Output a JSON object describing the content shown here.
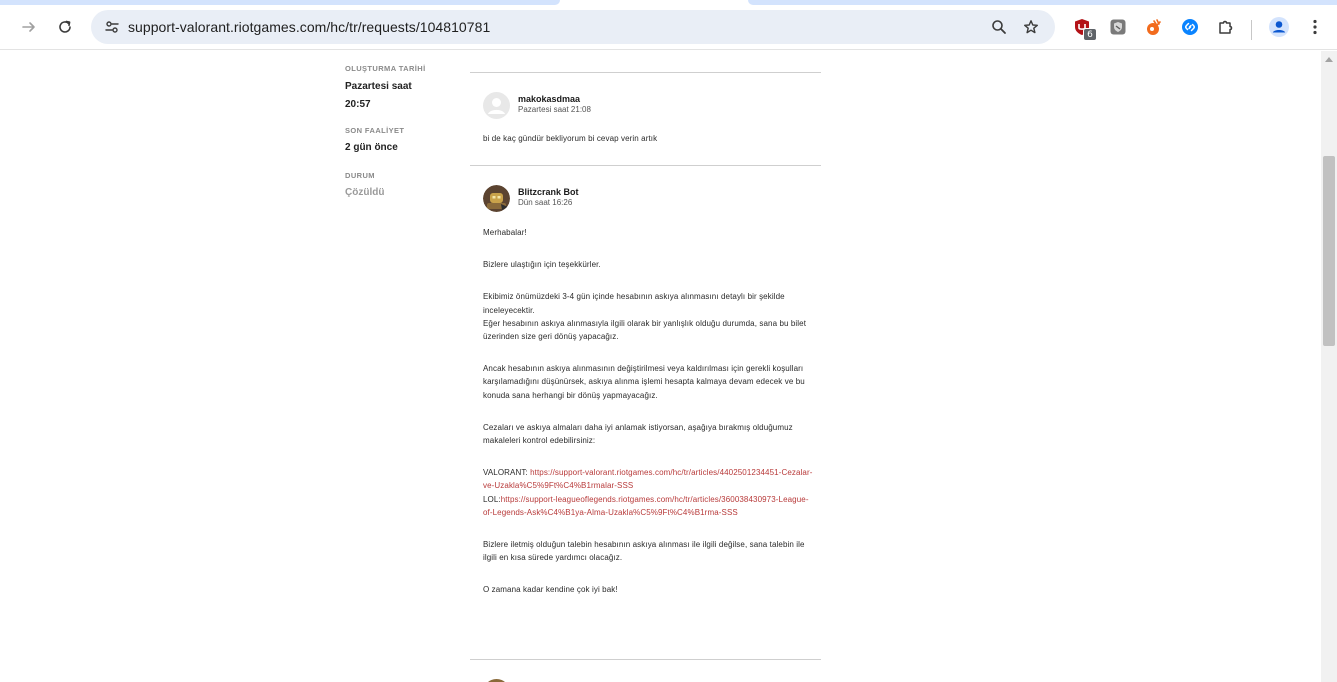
{
  "browser": {
    "url": "support-valorant.riotgames.com/hc/tr/requests/104810781",
    "extensions": [
      {
        "name": "ublock-shield",
        "color": "#b31217",
        "badge": "6"
      },
      {
        "name": "privacy-badger",
        "color": "#6b6b6b"
      },
      {
        "name": "orange-extension",
        "color": "#f26b1d"
      },
      {
        "name": "shazam",
        "color": "#0a84ff"
      }
    ]
  },
  "sidebar": {
    "created_label": "OLUŞTURMA TARİHİ",
    "created_value_line1": "Pazartesi saat",
    "created_value_line2": "20:57",
    "activity_label": "SON FAALİYET",
    "activity_value": "2 gün önce",
    "status_label": "DURUM",
    "status_value": "Çözüldü"
  },
  "comments": [
    {
      "author": "makokasdmaa",
      "time": "Pazartesi saat 21:08",
      "text": "bi de kaç gündür bekliyorum bi cevap verin artık"
    },
    {
      "author": "Blitzcrank Bot",
      "time": "Dün saat 16:26",
      "p1": "Merhabalar!",
      "p2": "Bizlere ulaştığın için teşekkürler.",
      "p3a": "Ekibimiz önümüzdeki 3-4 gün içinde hesabının askıya alınmasını detaylı bir şekilde inceleyecektir.",
      "p3b": "Eğer hesabının askıya alınmasıyla ilgili olarak bir yanlışlık olduğu durumda, sana bu bilet üzerinden size geri dönüş yapacağız.",
      "p4": "Ancak hesabının askıya alınmasının değiştirilmesi veya kaldırılması için gerekli koşulları karşılamadığını düşünürsek, askıya alınma işlemi hesapta kalmaya devam edecek ve bu konuda sana herhangi bir dönüş yapmayacağız.",
      "p5": "Cezaları ve askıya almaları daha iyi anlamak istiyorsan, aşağıya bırakmış olduğumuz makaleleri kontrol edebilirsiniz:",
      "valorant_label": "VALORANT: ",
      "valorant_link": "https://support-valorant.riotgames.com/hc/tr/articles/4402501234451-Cezalar-ve-Uzakla%C5%9Ft%C4%B1rmalar-SSS",
      "lol_label": "LOL:",
      "lol_link": "https://support-leagueoflegends.riotgames.com/hc/tr/articles/360038430973-League-of-Legends-Ask%C4%B1ya-Alma-Uzakla%C5%9Ft%C4%B1rma-SSS",
      "p7": "Bizlere iletmiş olduğun talebin hesabının askıya alınması ile ilgili değilse, sana talebin ile ilgili en kısa sürede yardımcı olacağız.",
      "p8": "O zamana kadar kendine çok iyi bak!"
    }
  ]
}
